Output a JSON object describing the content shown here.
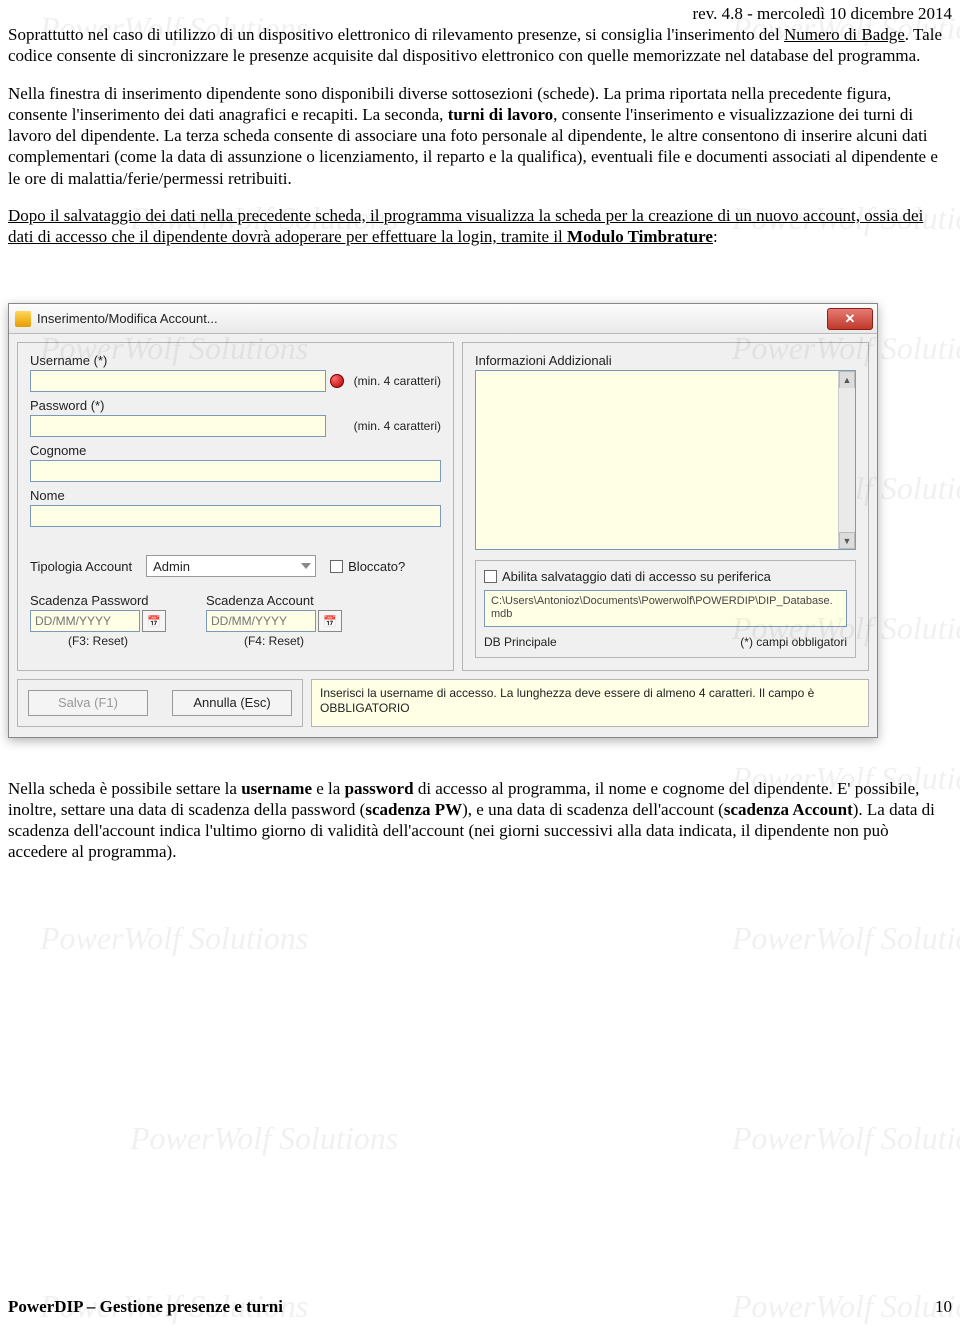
{
  "header": {
    "rev": "rev. 4.8 - mercoledì 10 dicembre 2014"
  },
  "watermark": "PowerWolf Solutions",
  "para1_a": "Soprattutto nel caso di utilizzo di un dispositivo elettronico di rilevamento presenze, si consiglia l'inserimento del ",
  "para1_link": "Numero di Badge",
  "para1_b": ". Tale codice consente di sincronizzare le presenze acquisite dal dispositivo elettronico con quelle memorizzate nel database del programma.",
  "para2_a": "Nella finestra di inserimento dipendente sono disponibili diverse sottosezioni (schede). La prima riportata nella precedente figura, consente l'inserimento dei dati anagrafici e recapiti. La seconda, ",
  "para2_b1": "turni di lavoro",
  "para2_c": ", consente l'inserimento e visualizzazione dei turni di lavoro del dipendente. La terza scheda consente di associare una foto personale al dipendente, le altre consentono di inserire alcuni dati complementari (come la data di assunzione o licenziamento, il reparto e la qualifica), eventuali file e documenti associati al dipendente e le ore di malattia/ferie/permessi retribuiti.",
  "para3_a": "Dopo il salvataggio dei dati nella precedente scheda, il programma visualizza la scheda per la creazione di un nuovo account, ossia dei dati di accesso che il dipendente dovrà adoperare per effettuare la login, tramite il ",
  "para3_link": "Modulo Timbrature",
  "para3_b": ":",
  "dialog": {
    "title": "Inserimento/Modifica Account...",
    "username_label": "Username (*)",
    "password_label": "Password (*)",
    "min_chars": "(min. 4 caratteri)",
    "cognome_label": "Cognome",
    "nome_label": "Nome",
    "account_type_label": "Tipologia Account",
    "account_type_value": "Admin",
    "blocked_label": "Bloccato?",
    "scad_pw_label": "Scadenza Password",
    "scad_acc_label": "Scadenza Account",
    "date_placeholder": "DD/MM/YYYY",
    "f3_reset": "(F3: Reset)",
    "f4_reset": "(F4: Reset)",
    "info_add_label": "Informazioni Addizionali",
    "save_periph_label": "Abilita salvataggio dati di accesso su periferica",
    "db_path": "C:\\Users\\Antonioz\\Documents\\Powerwolf\\POWERDIP\\DIP_Database.mdb",
    "db_label": "DB Principale",
    "required_note": "(*) campi obbligatori",
    "save_btn": "Salva (F1)",
    "cancel_btn": "Annulla (Esc)",
    "help_msg": "Inserisci la username di accesso. La lunghezza deve essere di almeno 4 caratteri. Il campo è OBBLIGATORIO"
  },
  "para4_a": "Nella scheda è possibile settare la ",
  "para4_b1": "username",
  "para4_c": " e la ",
  "para4_b2": "password",
  "para4_d": " di accesso al programma, il nome e cognome del dipendente. E' possibile, inoltre, settare una data di scadenza della password (",
  "para4_b3": "scadenza PW",
  "para4_e": "), e una data di scadenza dell'account (",
  "para4_b4": "scadenza Account",
  "para4_f": "). La data di scadenza dell'account indica l'ultimo giorno di validità dell'account (nei giorni successivi alla data indicata, il dipendente non può accedere al programma).",
  "footer": {
    "left": "PowerDIP – Gestione presenze e turni",
    "page": "10"
  }
}
